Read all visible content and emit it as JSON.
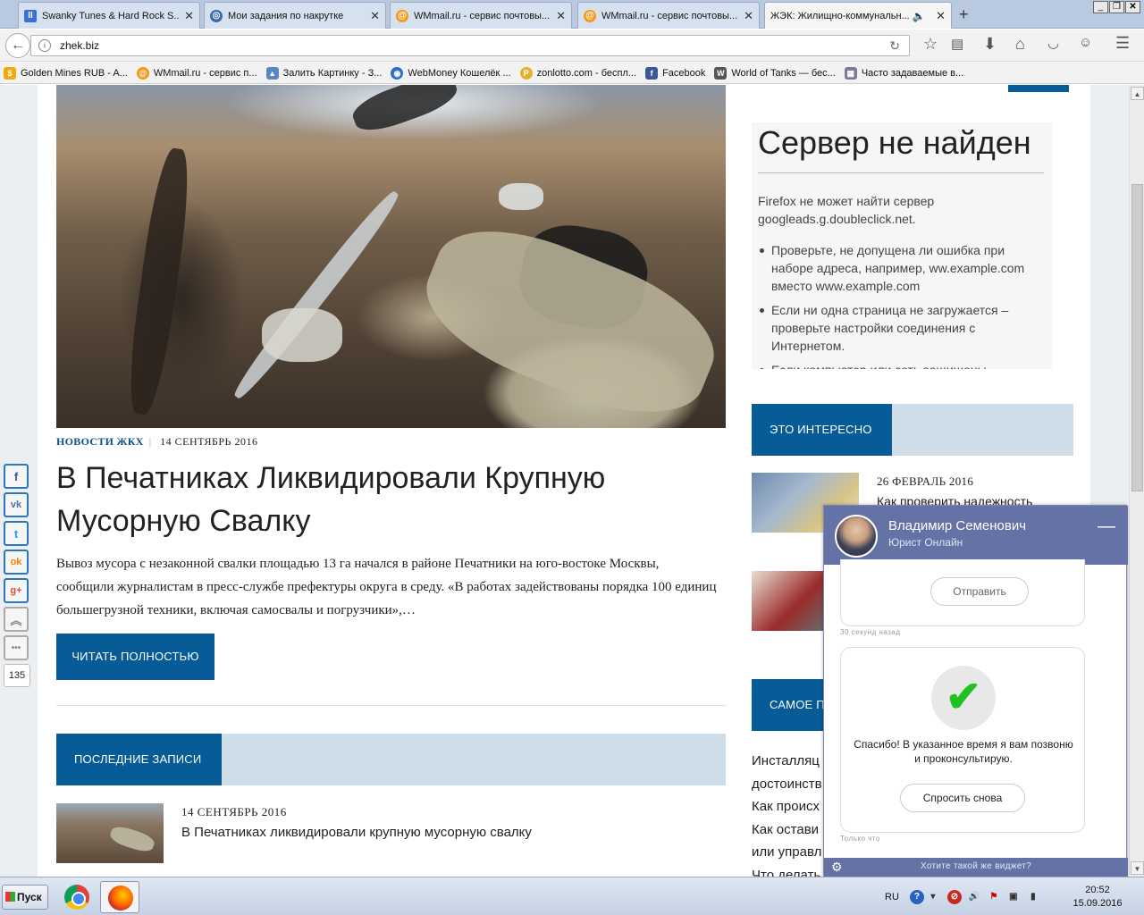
{
  "browser": {
    "tabs": [
      {
        "label": "Swanky Tunes & Hard Rock S...",
        "icon": "pause-icon",
        "color": "#3a6fd8"
      },
      {
        "label": "Мои задания по накрутке",
        "icon": "circle-target-icon",
        "color": "#3b6ea8"
      },
      {
        "label": "WMmail.ru - сервис почтовы...",
        "icon": "at-icon",
        "color": "#f39a1b"
      },
      {
        "label": "WMmail.ru - сервис почтовы...",
        "icon": "at-icon",
        "color": "#f39a1b"
      },
      {
        "label": "ЖЭК: Жилищно-коммунальн...",
        "icon": "speaker-icon",
        "color": "#888888"
      }
    ],
    "new_tab": "+",
    "url": "zhek.biz",
    "bookmarks": [
      {
        "label": "Golden Mines RUB - A...",
        "color": "#f0a90e"
      },
      {
        "label": "WMmail.ru - сервис п...",
        "color": "#f39a1b"
      },
      {
        "label": "Залить Картинку - З...",
        "color": "#5b86c4"
      },
      {
        "label": "WebMoney Кошелёк ...",
        "color": "#2b6fc7"
      },
      {
        "label": "zonlotto.com - беспл...",
        "color": "#e2b22c"
      },
      {
        "label": "Facebook",
        "color": "#3b5998"
      },
      {
        "label": "World of Tanks — бес...",
        "color": "#555555"
      },
      {
        "label": "Часто задаваемые в...",
        "color": "#7a7a99"
      }
    ]
  },
  "article": {
    "category": "НОВОСТИ ЖКХ",
    "date": "14 СЕНТЯБРЬ 2016",
    "title": "В Печатниках Ликвидировали Крупную Мусорную Свалку",
    "excerpt": "Вывоз мусора с незаконной свалки площадью 13 га начался в районе Печатники на юго-востоке Москвы, сообщили журналистам в пресс-службе префектуры округа в среду. «В работах задействованы порядка 100 единиц большегрузной техники, включая самосвалы и погрузчики»,…",
    "read_more": "ЧИТАТЬ ПОЛНОСТЬЮ"
  },
  "latest": {
    "heading": "ПОСЛЕДНИЕ ЗАПИСИ",
    "item_date": "14 СЕНТЯБРЬ 2016",
    "item_title": "В Печатниках ликвидировали крупную мусорную свалку"
  },
  "server_error": {
    "title": "Сервер не найден",
    "message": "Firefox не может найти сервер googleads.g.doubleclick.net.",
    "bullets": [
      "Проверьте, не допущена ли ошибка при наборе адреса, например, ww.example.com вместо www.example.com",
      "Если ни одна страница не загружается – проверьте настройки соединения с Интернетом.",
      "Если компьютер или сеть защищены"
    ]
  },
  "interesting": {
    "heading": "ЭТО ИНТЕРЕСНО",
    "item_date": "26 ФЕВРАЛЬ 2016",
    "item_title": "Как проверить надежность"
  },
  "popular": {
    "heading": "САМОЕ П",
    "links": [
      "Инсталляц",
      "достоинств",
      "Как происх",
      "Как остави",
      "или управл",
      "Что делать"
    ]
  },
  "share": {
    "buttons": [
      {
        "icon": "facebook-icon",
        "glyph": "f",
        "color": "#3b5998"
      },
      {
        "icon": "vk-icon",
        "glyph": "vk",
        "color": "#4a76a8"
      },
      {
        "icon": "twitter-icon",
        "glyph": "t",
        "color": "#1da1f2"
      },
      {
        "icon": "odnoklassniki-icon",
        "glyph": "ok",
        "color": "#ee8208"
      },
      {
        "icon": "google-plus-icon",
        "glyph": "g+",
        "color": "#dd4b39"
      },
      {
        "icon": "scroll-up-icon",
        "glyph": "︽",
        "color": "#888888"
      },
      {
        "icon": "more-icon",
        "glyph": "•••",
        "color": "#888888"
      }
    ],
    "count": "135"
  },
  "widget": {
    "name": "Владимир Семенович",
    "role": "Юрист Онлайн",
    "send": "Отправить",
    "time1": "30 секунд назад",
    "thanks": "Спасибо! В указанное время я вам позвоню и проконсультирую.",
    "ask_again": "Спросить снова",
    "time2": "Только что",
    "footer": "Хотите такой же виджет?"
  },
  "taskbar": {
    "start": "Пуск",
    "lang": "RU",
    "time": "20:52",
    "date": "15.09.2016"
  }
}
